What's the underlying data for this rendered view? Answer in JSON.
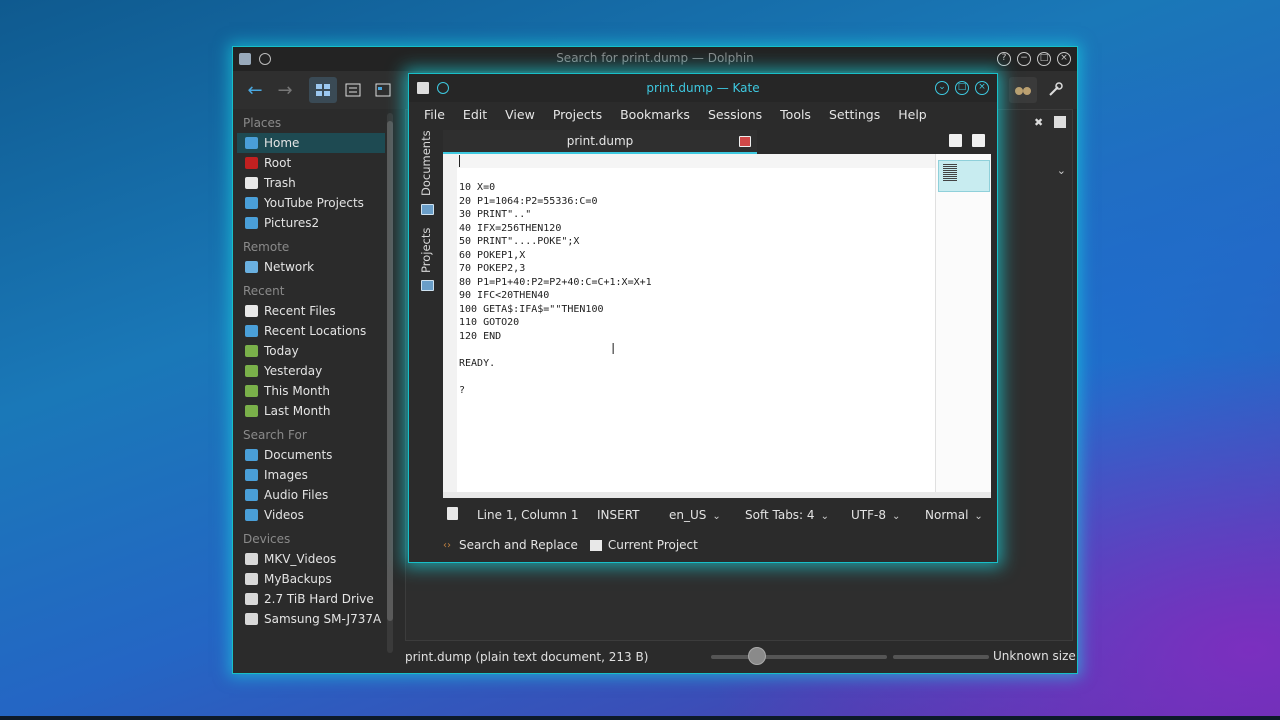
{
  "dolphin": {
    "title": "Search for print.dump — Dolphin",
    "places_sections": [
      {
        "header": "Places",
        "items": [
          {
            "label": "Home",
            "selected": true,
            "color": "#4a9fd8"
          },
          {
            "label": "Root",
            "color": "#c22020"
          },
          {
            "label": "Trash",
            "color": "#e8e8e8"
          },
          {
            "label": "YouTube Projects",
            "color": "#4a9fd8"
          },
          {
            "label": "Pictures2",
            "color": "#4a9fd8"
          }
        ]
      },
      {
        "header": "Remote",
        "items": [
          {
            "label": "Network",
            "color": "#6ab0e0"
          }
        ]
      },
      {
        "header": "Recent",
        "items": [
          {
            "label": "Recent Files",
            "color": "#e8e8e8"
          },
          {
            "label": "Recent Locations",
            "color": "#4a9fd8"
          },
          {
            "label": "Today",
            "color": "#7ab04a"
          },
          {
            "label": "Yesterday",
            "color": "#7ab04a"
          },
          {
            "label": "This Month",
            "color": "#7ab04a"
          },
          {
            "label": "Last Month",
            "color": "#7ab04a"
          }
        ]
      },
      {
        "header": "Search For",
        "items": [
          {
            "label": "Documents",
            "color": "#4a9fd8"
          },
          {
            "label": "Images",
            "color": "#4a9fd8"
          },
          {
            "label": "Audio Files",
            "color": "#4a9fd8"
          },
          {
            "label": "Videos",
            "color": "#4a9fd8"
          }
        ]
      },
      {
        "header": "Devices",
        "items": [
          {
            "label": "MKV_Videos",
            "color": "#d8d8d8"
          },
          {
            "label": "MyBackups",
            "color": "#d8d8d8"
          },
          {
            "label": "2.7 TiB Hard Drive",
            "color": "#d8d8d8"
          },
          {
            "label": "Samsung SM-J737A",
            "color": "#d8d8d8"
          }
        ]
      }
    ],
    "status_text": "print.dump (plain text document, 213 B)",
    "free_space": "Unknown size"
  },
  "kate": {
    "title": "print.dump — Kate",
    "menu": [
      "File",
      "Edit",
      "View",
      "Projects",
      "Bookmarks",
      "Sessions",
      "Tools",
      "Settings",
      "Help"
    ],
    "side_tabs": [
      "Documents",
      "Projects"
    ],
    "tab_label": "print.dump",
    "code_lines": [
      "10 X=0",
      "20 P1=1064:P2=55336:C=0",
      "30 PRINT\"..\"",
      "40 IFX=256THEN120",
      "50 PRINT\"....POKE\";X",
      "60 POKEP1,X",
      "70 POKEP2,3",
      "80 P1=P1+40:P2=P2+40:C=C+1:X=X+1",
      "90 IFC<20THEN40",
      "100 GETA$:IFA$=\"\"THEN100",
      "110 GOTO20",
      "120 END",
      "",
      "READY.",
      "",
      "?"
    ],
    "status": {
      "position": "Line 1, Column 1",
      "mode": "INSERT",
      "language": "en_US",
      "indent": "Soft Tabs: 4",
      "encoding": "UTF-8",
      "highlight": "Normal"
    },
    "bottom_tools": [
      "Search and Replace",
      "Current Project"
    ]
  }
}
